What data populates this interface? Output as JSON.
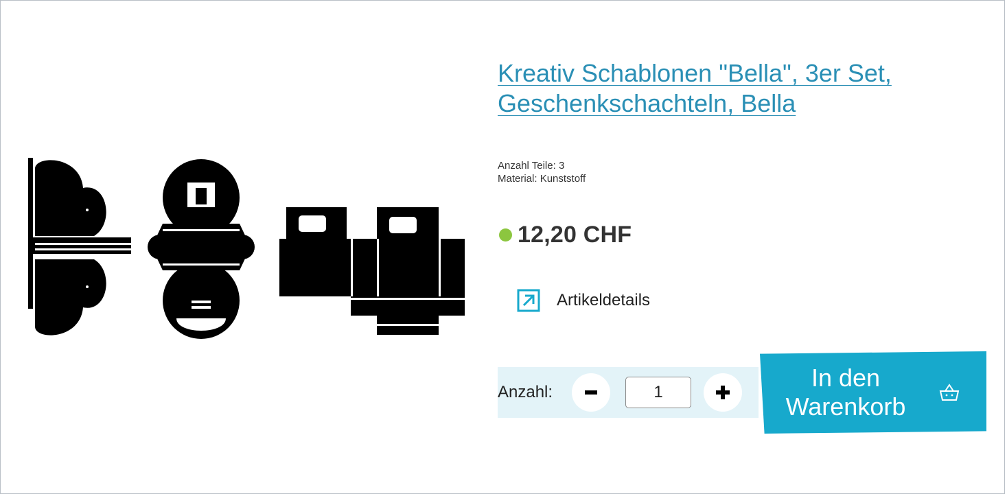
{
  "product": {
    "title": "Kreativ Schablonen \"Bella\", 3er Set, Geschenkschachteln, Bella",
    "properties": [
      {
        "label": "Anzahl Teile:",
        "value": "3"
      },
      {
        "label": "Material:",
        "value": "Kunststoff"
      }
    ],
    "price": "12,20 CHF",
    "availability_color": "#8cc63f",
    "details_label": "Artikeldetails",
    "details_icon": "external-link-arrow-icon"
  },
  "quantity": {
    "label": "Anzahl:",
    "value": "1",
    "minus_icon": "minus-icon",
    "plus_icon": "plus-icon"
  },
  "cart": {
    "label": "In den Warenkorb",
    "icon": "basket-icon",
    "color": "#17a9cc"
  },
  "colors": {
    "accent": "#2a8fb5",
    "qty_background": "#e3f3f8"
  }
}
